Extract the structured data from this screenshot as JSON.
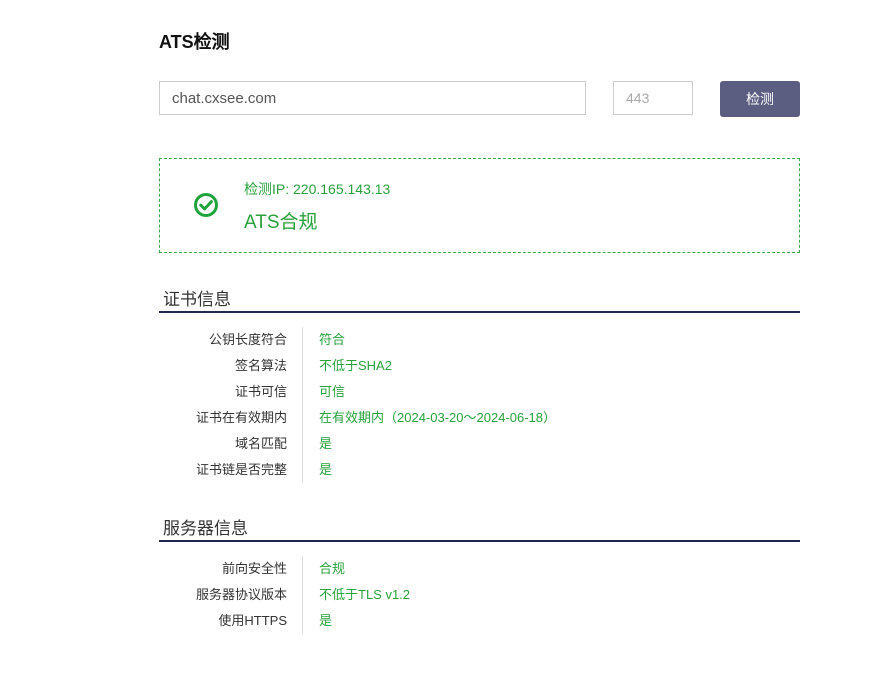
{
  "header": {
    "title": "ATS检测"
  },
  "form": {
    "host_value": "chat.cxsee.com",
    "port_placeholder": "443",
    "check_label": "检测"
  },
  "result": {
    "ip_label": "检测IP: 220.165.143.13",
    "status": "ATS合规",
    "status_color": "#2aa13c"
  },
  "cert_section": {
    "title": "证书信息",
    "rows": [
      {
        "label": "公钥长度符合",
        "value": "符合"
      },
      {
        "label": "签名算法",
        "value": "不低于SHA2"
      },
      {
        "label": "证书可信",
        "value": "可信"
      },
      {
        "label": "证书在有效期内",
        "value": "在有效期内（2024-03-20～2024-06-18）"
      },
      {
        "label": "域名匹配",
        "value": "是"
      },
      {
        "label": "证书链是否完整",
        "value": "是"
      }
    ]
  },
  "server_section": {
    "title": "服务器信息",
    "rows": [
      {
        "label": "前向安全性",
        "value": "合规"
      },
      {
        "label": "服务器协议版本",
        "value": "不低于TLS v1.2"
      },
      {
        "label": "使用HTTPS",
        "value": "是"
      }
    ]
  },
  "colors": {
    "accent_button": "#5b5e80",
    "success_green": "#2aa13c",
    "section_line": "#1f2a4d"
  },
  "icons": {
    "result_icon": "check-circle-icon"
  }
}
